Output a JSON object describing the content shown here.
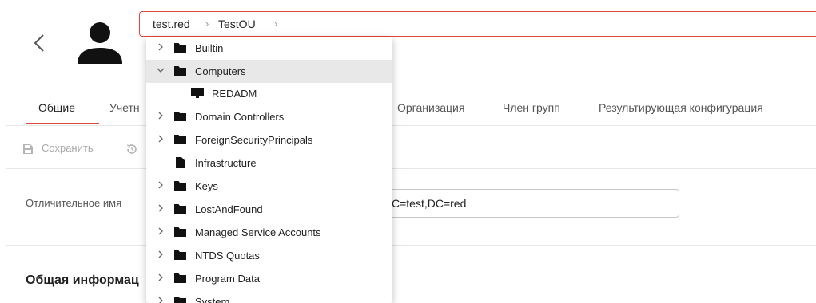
{
  "header": {
    "breadcrumbs": [
      "test.red",
      "TestOU"
    ]
  },
  "tabs": [
    {
      "label": "Общие"
    },
    {
      "label": "Учетн"
    },
    {
      "label": "Организация"
    },
    {
      "label": "Член групп"
    },
    {
      "label": "Результирующая конфигурация"
    }
  ],
  "toolbar": {
    "save_label": "Сохранить"
  },
  "form": {
    "dn_label": "Отличительное имя",
    "dn_value": "J,DC=test,DC=red",
    "section_title": "Общая информац"
  },
  "tree": {
    "items": [
      {
        "label": "Builtin",
        "icon": "folder-icon",
        "expandable": true
      },
      {
        "label": "Computers",
        "icon": "folder-icon",
        "expandable": true,
        "expanded": true,
        "selected": true
      },
      {
        "label": "REDADM",
        "icon": "computer-icon",
        "expandable": false,
        "child": true
      },
      {
        "label": "Domain Controllers",
        "icon": "folder-icon",
        "expandable": true
      },
      {
        "label": "ForeignSecurityPrincipals",
        "icon": "folder-icon",
        "expandable": true
      },
      {
        "label": "Infrastructure",
        "icon": "file-icon",
        "expandable": false
      },
      {
        "label": "Keys",
        "icon": "folder-icon",
        "expandable": true
      },
      {
        "label": "LostAndFound",
        "icon": "folder-icon",
        "expandable": true
      },
      {
        "label": "Managed Service Accounts",
        "icon": "folder-icon",
        "expandable": true
      },
      {
        "label": "NTDS Quotas",
        "icon": "folder-icon",
        "expandable": true
      },
      {
        "label": "Program Data",
        "icon": "folder-icon",
        "expandable": true
      },
      {
        "label": "System",
        "icon": "folder-icon",
        "expandable": true
      }
    ]
  },
  "colors": {
    "accent": "#d94a3c",
    "selected_row": "#e8e8e8"
  }
}
